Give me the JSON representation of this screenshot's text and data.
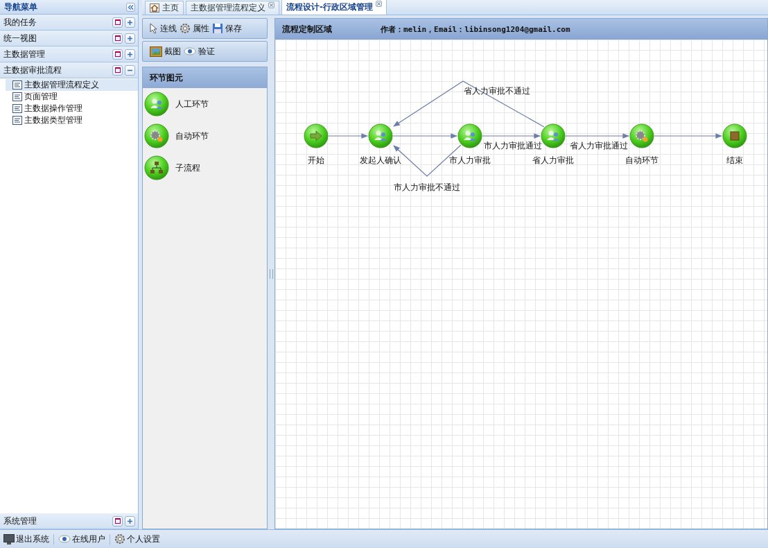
{
  "sidebar": {
    "title": "导航菜单",
    "sections": [
      {
        "label": "我的任务",
        "expanded": false
      },
      {
        "label": "统一视图",
        "expanded": false
      },
      {
        "label": "主数据管理",
        "expanded": false
      },
      {
        "label": "主数据审批流程",
        "expanded": true,
        "children": [
          {
            "label": "主数据管理流程定义",
            "selected": true
          },
          {
            "label": "页面管理",
            "selected": false
          },
          {
            "label": "主数据操作管理",
            "selected": false
          },
          {
            "label": "主数据类型管理",
            "selected": false
          }
        ]
      }
    ],
    "bottom_section": {
      "label": "系统管理",
      "expanded": false
    }
  },
  "tabs": [
    {
      "label": "主页",
      "kind": "home",
      "selected": false
    },
    {
      "label": "主数据管理流程定义",
      "kind": "closable",
      "selected": false
    },
    {
      "label": "流程设计-行政区域管理",
      "kind": "closable",
      "selected": true
    }
  ],
  "toolbar": [
    [
      {
        "label": "连线",
        "kind": "pointer"
      },
      {
        "label": "属性",
        "kind": "gear"
      },
      {
        "label": "保存",
        "kind": "disk"
      }
    ],
    [
      {
        "label": "截图",
        "kind": "picture"
      },
      {
        "label": "验证",
        "kind": "eye"
      }
    ]
  ],
  "palette": {
    "title": "环节图元",
    "items": [
      {
        "label": "人工环节",
        "kind": "human"
      },
      {
        "label": "自动环节",
        "kind": "auto"
      },
      {
        "label": "子流程",
        "kind": "subflow"
      }
    ]
  },
  "canvas": {
    "title": "流程定制区域",
    "author": "作者：melin，Email：libinsong1204@gmail.com",
    "nodes": [
      {
        "label": "开始",
        "kind": "start"
      },
      {
        "label": "发起人确认",
        "kind": "human"
      },
      {
        "label": "市人力审批",
        "kind": "human"
      },
      {
        "label": "省人力审批",
        "kind": "human"
      },
      {
        "label": "自动环节",
        "kind": "auto"
      },
      {
        "label": "结束",
        "kind": "end"
      }
    ],
    "edges": [
      {
        "kind": "arrow"
      },
      {
        "kind": "arrow"
      },
      {
        "kind": "arrow",
        "label": "省人力审批不通过"
      },
      {
        "kind": "arrow",
        "label": "市人力审批通过"
      },
      {
        "kind": "arrow",
        "label": "省人力审批通过"
      },
      {
        "kind": "arrow",
        "label": "市人力审批不通过"
      },
      {
        "kind": "arrow"
      }
    ]
  },
  "status_bar": [
    {
      "label": "退出系统",
      "kind": "monitor"
    },
    {
      "label": "在线用户",
      "kind": "eye"
    },
    {
      "label": "个人设置",
      "kind": "gear"
    }
  ]
}
